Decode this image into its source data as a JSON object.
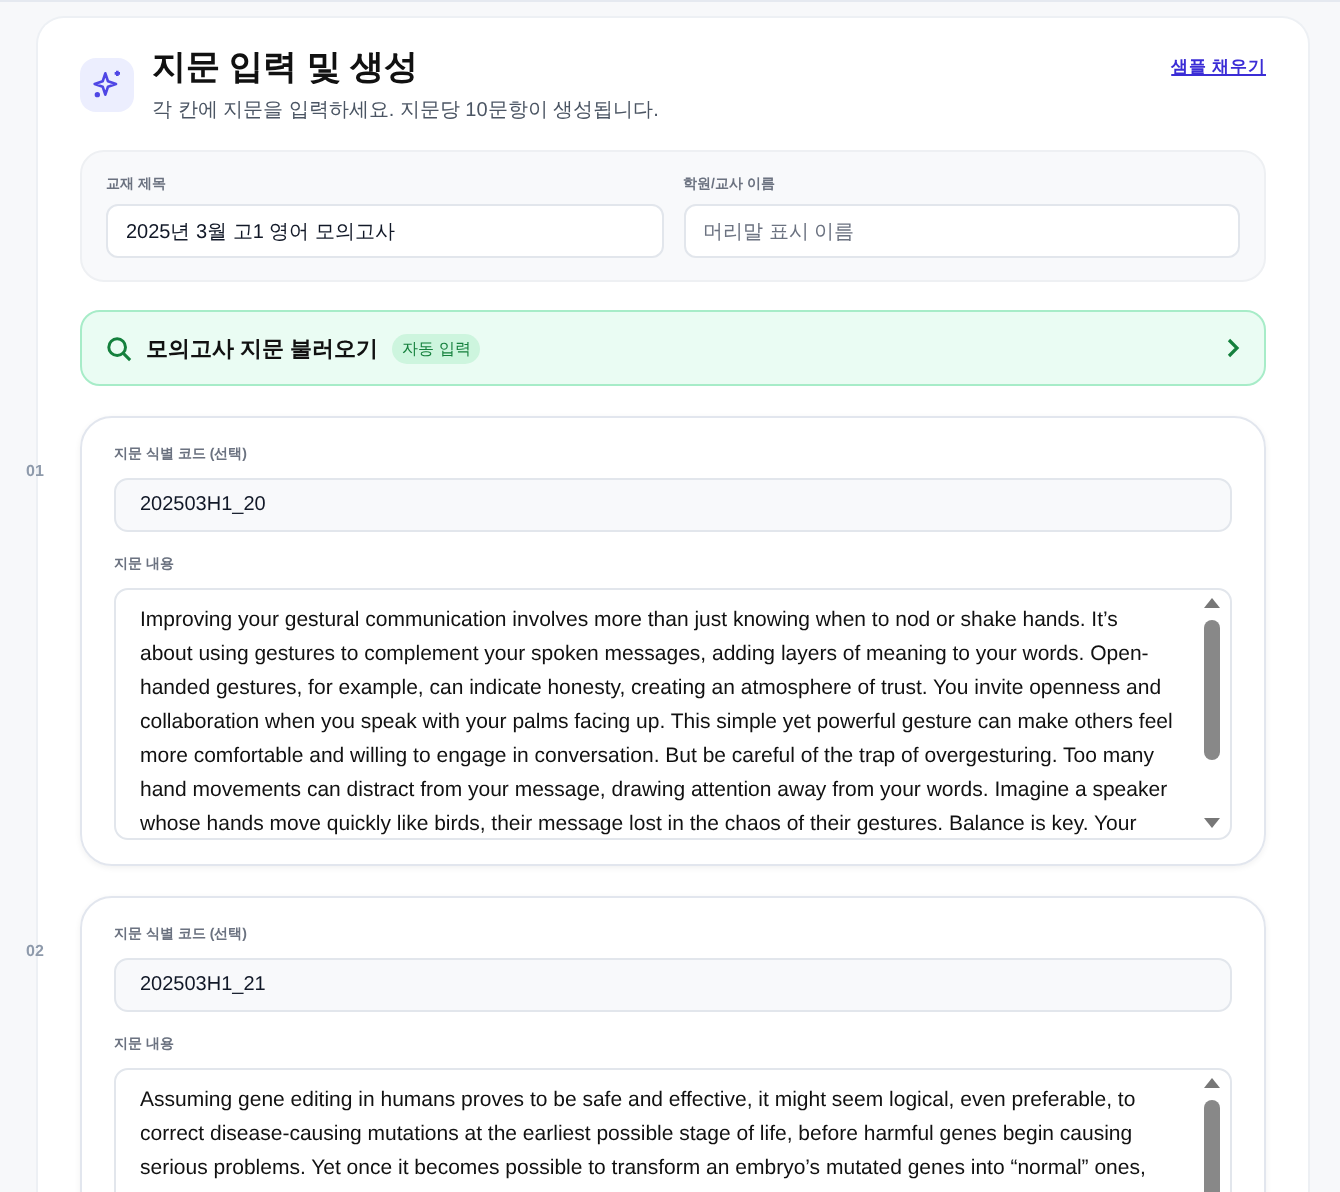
{
  "header": {
    "title": "지문 입력 및 생성",
    "subtitle": "각 칸에 지문을 입력하세요. 지문당 10문항이 생성됩니다.",
    "sample_link": "샘플 채우기"
  },
  "meta": {
    "fields": [
      {
        "label": "교재 제목",
        "value": "2025년 3월 고1 영어 모의고사"
      },
      {
        "label": "학원/교사 이름",
        "placeholder": "머리말 표시 이름"
      }
    ]
  },
  "import_bar": {
    "label": "모의고사 지문 불러오기",
    "badge": "자동 입력"
  },
  "passages": [
    {
      "number": "01",
      "code_label": "지문 식별 코드 (선택)",
      "code": "202503H1_20",
      "content_label": "지문 내용",
      "content": "Improving your gestural communication involves more than just knowing when to nod or shake hands. It’s\nabout using gestures to complement your spoken messages, adding layers of meaning to your words. Open-\nhanded gestures, for example, can indicate honesty, creating an atmosphere of trust. You invite openness and\ncollaboration when you speak with your palms facing up. This simple yet powerful gesture can make others feel\nmore comfortable and willing to engage in conversation. But be careful of the trap of overgesturing. Too many\nhand movements can distract from your message, drawing attention away from your words. Imagine a speaker\nwhose hands move quickly like birds, their message lost in the chaos of their gestures. Balance is key. Your"
    },
    {
      "number": "02",
      "code_label": "지문 식별 코드 (선택)",
      "code": "202503H1_21",
      "content_label": "지문 내용",
      "content": "Assuming gene editing in humans proves to be safe and effective, it might seem logical, even preferable, to\ncorrect disease-causing mutations at the earliest possible stage of life, before harmful genes begin causing\nserious problems. Yet once it becomes possible to transform an embryo’s mutated genes into “normal” ones,"
    }
  ]
}
